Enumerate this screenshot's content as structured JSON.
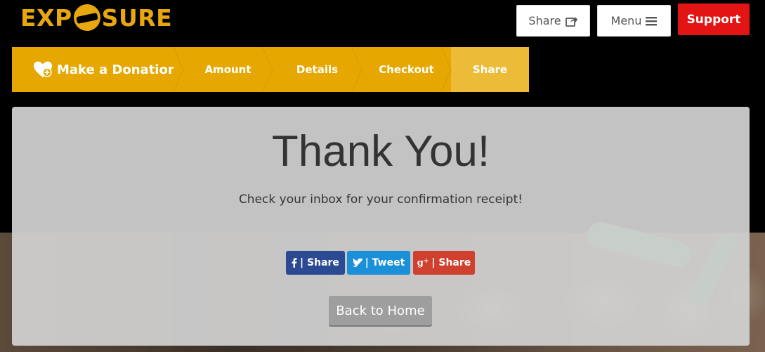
{
  "brand": {
    "logo_left": "EXP",
    "logo_right": "SURE",
    "accent": "#e6a800"
  },
  "header": {
    "share_label": "Share",
    "share_icon": "external-share-icon",
    "menu_label": "Menu",
    "menu_icon": "hamburger-icon",
    "support_label": "Support",
    "support_color": "#e21414"
  },
  "steps": {
    "title": "Make a Donation",
    "title_icon": "heart-plus-icon",
    "items": [
      "Amount",
      "Details",
      "Checkout",
      "Share"
    ],
    "active_index": 3
  },
  "main": {
    "title": "Thank You!",
    "subtitle": "Check your inbox for your confirmation receipt!",
    "facebook_label": "| Share",
    "twitter_label": "| Tweet",
    "google_label": "| Share",
    "back_label": "Back to Home"
  },
  "colors": {
    "facebook": "#2b4a93",
    "twitter": "#1a90d8",
    "google": "#d0402f"
  }
}
